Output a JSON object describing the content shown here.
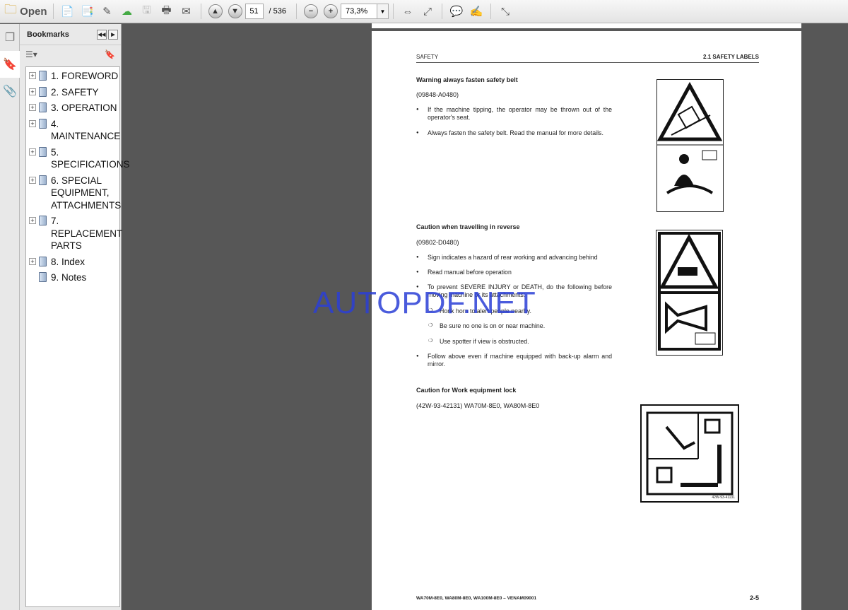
{
  "toolbar": {
    "open_label": "Open",
    "current_page": "51",
    "page_total": "/ 536",
    "zoom": "73,3%"
  },
  "bookmarks": {
    "title": "Bookmarks",
    "items": [
      {
        "label": "1. FOREWORD",
        "expandable": true
      },
      {
        "label": "2. SAFETY",
        "expandable": true
      },
      {
        "label": "3. OPERATION",
        "expandable": true
      },
      {
        "label": "4. MAINTENANCE",
        "expandable": true
      },
      {
        "label": "5. SPECIFICATIONS",
        "expandable": true
      },
      {
        "label": "6. SPECIAL EQUIPMENT, ATTACHMENTS",
        "expandable": true
      },
      {
        "label": "7. REPLACEMENT PARTS",
        "expandable": true
      },
      {
        "label": "8. Index",
        "expandable": true
      },
      {
        "label": "9. Notes",
        "expandable": false
      }
    ]
  },
  "page": {
    "header_left": "SAFETY",
    "header_right": "2.1  SAFETY LABELS",
    "s1": {
      "title": "Warning always fasten safety belt",
      "code": "(09848-A0480)",
      "bullets": [
        "If the machine tipping, the operator may be thrown out of the operator's seat.",
        "Always fasten the safety belt. Read the manual for more details."
      ]
    },
    "s2": {
      "title": "Caution when travelling in reverse",
      "code": "(09802-D0480)",
      "bullets": [
        "Sign indicates a hazard of rear working and advancing behind",
        "Read manual before operation",
        "To prevent SEVERE INJURY or DEATH, do the following before moving machine or its attachments:"
      ],
      "subs": [
        "Honk horn to alert people nearby.",
        "Be sure no one is on or near machine.",
        "Use spotter if view is obstructed."
      ],
      "last": "Follow above even if machine equipped with back-up alarm and mirror."
    },
    "s3": {
      "title": "Caution for Work equipment lock",
      "code": "(42W-93-42131) WA70M-8E0, WA80M-8E0",
      "label_code": "42W-93-41131"
    },
    "footer_left": "WA70M-8E0, WA80M-8E0, WA100M-8E0 – VENAM09001",
    "footer_right": "2-5"
  },
  "watermark": "AUTOPDF.NET",
  "colors": {
    "watermark": "#2b3fd6",
    "viewer_bg": "#575757"
  }
}
